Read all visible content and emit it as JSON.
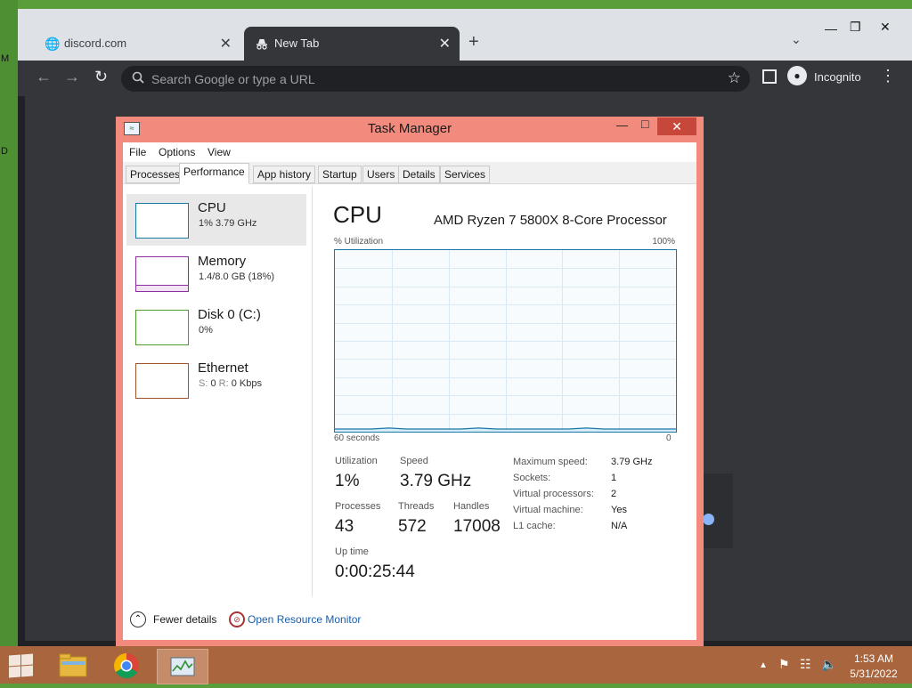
{
  "desktop": {
    "edge_letters": [
      "M",
      "D"
    ]
  },
  "chrome": {
    "tabs": [
      {
        "label": "discord.com",
        "icon": "globe-icon"
      },
      {
        "label": "New Tab",
        "icon": "incognito-icon"
      }
    ],
    "omnibox_placeholder": "Search Google or type a URL",
    "profile_label": "Incognito"
  },
  "task_manager": {
    "title": "Task Manager",
    "menu": [
      "File",
      "Options",
      "View"
    ],
    "tabs": [
      "Processes",
      "Performance",
      "App history",
      "Startup",
      "Users",
      "Details",
      "Services"
    ],
    "active_tab": "Performance",
    "resources": [
      {
        "name": "CPU",
        "detail": "1%  3.79 GHz",
        "color": "#1a78a8"
      },
      {
        "name": "Memory",
        "detail": "1.4/8.0 GB (18%)",
        "color": "#8b2fa0"
      },
      {
        "name": "Disk 0 (C:)",
        "detail": "0%",
        "color": "#4d9a2a"
      },
      {
        "name": "Ethernet",
        "detail_s_label": "S:",
        "detail_s_value": "0",
        "detail_r_label": "R:",
        "detail_r_value": "0 Kbps",
        "color": "#a0522d"
      }
    ],
    "cpu": {
      "heading": "CPU",
      "model": "AMD Ryzen 7 5800X 8-Core Processor",
      "graph_label": "% Utilization",
      "graph_max": "100%",
      "graph_x_left": "60 seconds",
      "graph_x_right": "0",
      "utilization_history_percent": [
        1,
        1,
        1,
        1.5,
        1,
        1,
        1,
        1,
        1.5,
        1,
        1,
        1,
        1,
        1,
        1.5,
        1,
        1,
        1,
        1,
        1
      ],
      "stats": {
        "utilization_label": "Utilization",
        "utilization": "1%",
        "speed_label": "Speed",
        "speed": "3.79 GHz",
        "processes_label": "Processes",
        "processes": "43",
        "threads_label": "Threads",
        "threads": "572",
        "handles_label": "Handles",
        "handles": "17008",
        "uptime_label": "Up time",
        "uptime": "0:00:25:44"
      },
      "specs": [
        {
          "label": "Maximum speed:",
          "value": "3.79 GHz"
        },
        {
          "label": "Sockets:",
          "value": "1"
        },
        {
          "label": "Virtual processors:",
          "value": "2"
        },
        {
          "label": "Virtual machine:",
          "value": "Yes"
        },
        {
          "label": "L1 cache:",
          "value": "N/A"
        }
      ]
    },
    "footer": {
      "fewer_details": "Fewer details",
      "open_resource_monitor": "Open Resource Monitor"
    }
  },
  "taskbar": {
    "clock_time": "1:53 AM",
    "clock_date": "5/31/2022",
    "apps": [
      "file-explorer-icon",
      "chrome-icon",
      "task-manager-icon"
    ]
  }
}
